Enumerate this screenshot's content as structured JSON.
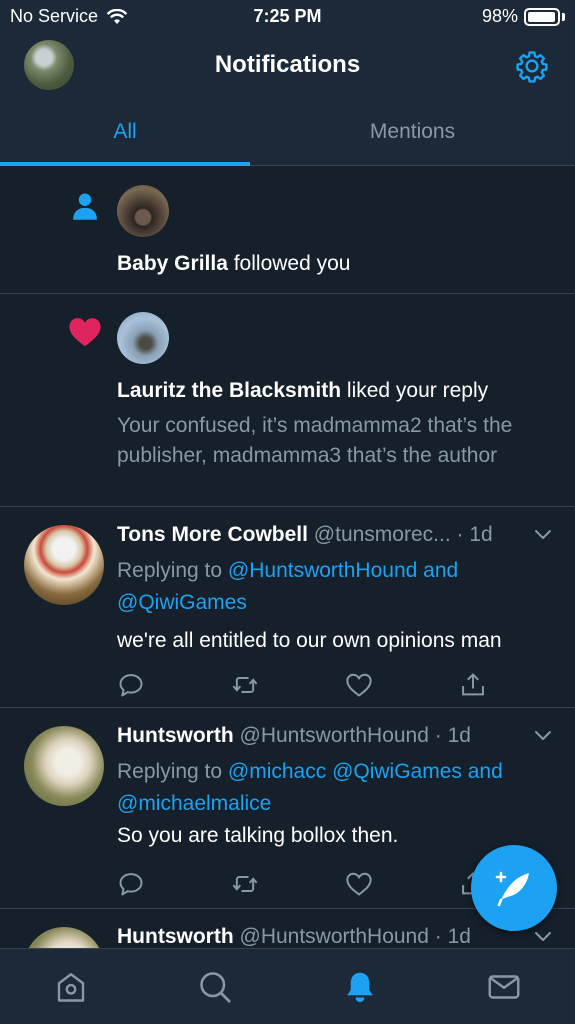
{
  "status_bar": {
    "carrier": "No Service",
    "time": "7:25 PM",
    "battery_percent": "98%",
    "battery_level": 0.98
  },
  "header": {
    "title": "Notifications"
  },
  "tabs": [
    {
      "label": "All",
      "active": true
    },
    {
      "label": "Mentions",
      "active": false
    }
  ],
  "notifications": [
    {
      "type": "follow",
      "icon": "person-icon",
      "user": "Baby Grilla",
      "action": " followed you"
    },
    {
      "type": "like",
      "icon": "heart-icon",
      "user": "Lauritz the Blacksmith",
      "action": " liked your reply",
      "body": "Your confused, it’s madmamma2 that’s the publisher, madmamma3 that’s the author"
    }
  ],
  "tweets": [
    {
      "name": "Tons More Cowbell",
      "handle": "@tunsmorec...",
      "time": "· 1d",
      "replying_prefix": "Replying to ",
      "replying_to": "@HuntsworthHound and @QiwiGames",
      "text": "we're all entitled to our own opinions man"
    },
    {
      "name": "Huntsworth",
      "handle": "@HuntsworthHound",
      "time": "· 1d",
      "replying_prefix": "Replying to ",
      "replying_to": "@michacc @QiwiGames and @michaelmalice",
      "text": "So you are talking bollox then."
    },
    {
      "name": "Huntsworth",
      "handle": "@HuntsworthHound",
      "time": "· 1d"
    }
  ],
  "colors": {
    "background": "#15202b",
    "bar": "#1c2938",
    "accent": "#1da1f2",
    "like": "#e0245e",
    "muted": "#8899a6"
  }
}
